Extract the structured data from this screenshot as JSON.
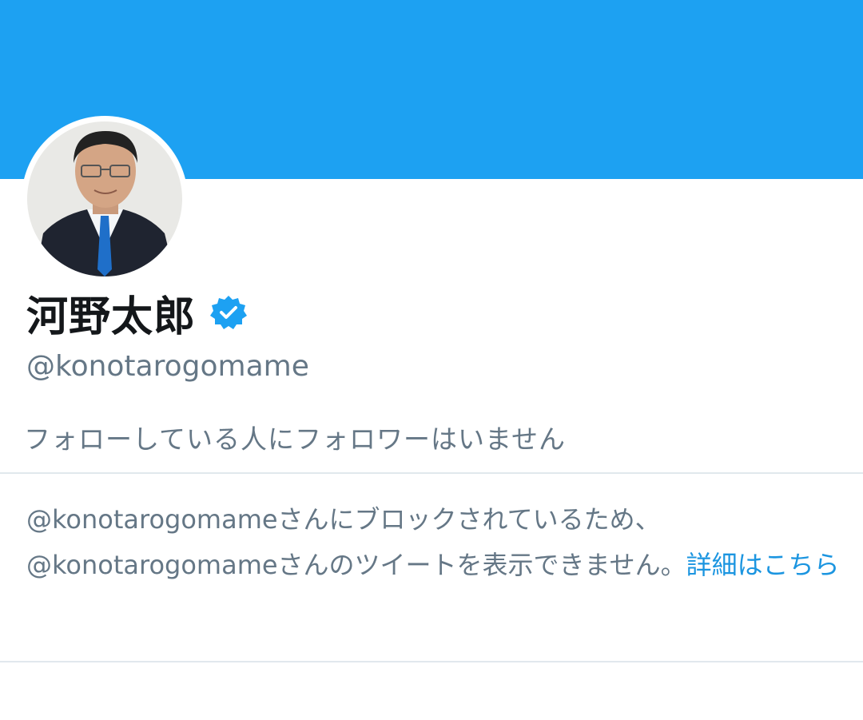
{
  "profile": {
    "display_name": "河野太郎",
    "handle": "@konotarogomame",
    "follow_note": "フォローしている人にフォロワーはいません"
  },
  "icons": {
    "verified": "verified-badge-icon",
    "avatar": "profile-avatar"
  },
  "blocked_notice": {
    "line1": "@konotarogomameさんにブロックされているため、",
    "line2": "@konotarogomameさんのツイートを表示できません。",
    "learn_more_label": "詳細はこちら"
  },
  "colors": {
    "banner": "#1da1f2",
    "verified": "#1da1f2",
    "link": "#1b95e0",
    "secondary_text": "#657786"
  }
}
